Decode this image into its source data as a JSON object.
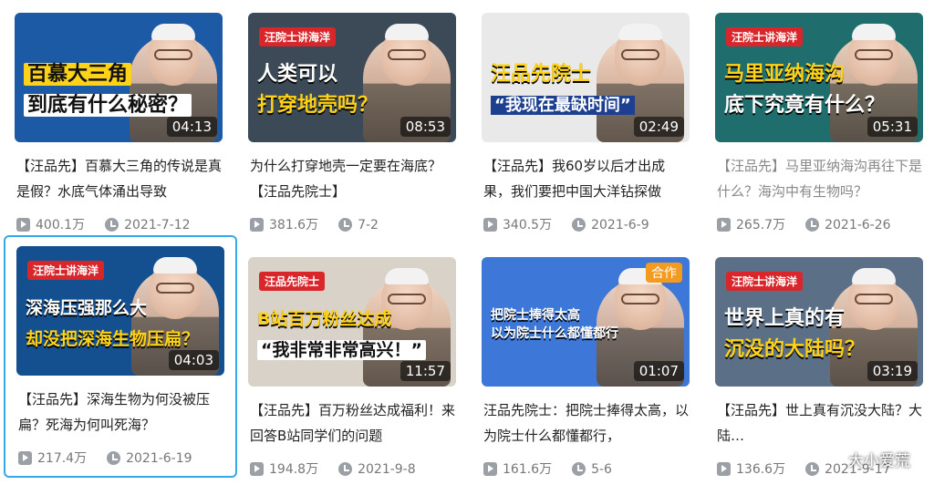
{
  "cards": [
    {
      "tag": "",
      "headline1": "百慕大三角",
      "headline2": "到底有什么秘密？",
      "duration": "04:13",
      "title": "【汪品先】百慕大三角的传说是真是假？水底气体涌出导致",
      "views": "400.1万",
      "date": "2021-7-12",
      "bg": "#1c5aa6"
    },
    {
      "tag": "汪院士讲海洋",
      "headline1": "人类可以",
      "headline2": "打穿地壳吗？",
      "duration": "08:53",
      "title": "为什么打穿地壳一定要在海底？【汪品先院士】",
      "views": "381.6万",
      "date": "7-2",
      "bg": "#3b4a56"
    },
    {
      "tag": "",
      "headline1": "汪品先院士",
      "headline2": "“我现在最缺时间”",
      "duration": "02:49",
      "title": "【汪品先】我60岁以后才出成果，我们要把中国大洋钻探做",
      "views": "340.5万",
      "date": "2021-6-9",
      "bg": "#e9e9e9"
    },
    {
      "tag": "汪院士讲海洋",
      "headline1": "马里亚纳海沟",
      "headline2": "底下究竟有什么？",
      "duration": "05:31",
      "title": "【汪品先】马里亚纳海沟再往下是什么？海沟中有生物吗？",
      "views": "265.7万",
      "date": "2021-6-26",
      "bg": "#1f6d6c"
    },
    {
      "tag": "汪院士讲海洋",
      "headline1": "深海压强那么大",
      "headline2": "却没把深海生物压扁？",
      "duration": "04:03",
      "title": "【汪品先】深海生物为何没被压扁？死海为何叫死海？",
      "views": "217.4万",
      "date": "2021-6-19",
      "bg": "#14508f"
    },
    {
      "tag": "汪品先院士",
      "headline1": "B站百万粉丝达成",
      "headline2": "“我非常非常高兴！”",
      "duration": "11:57",
      "title": "【汪品先】百万粉丝达成福利！来回答B站同学们的问题",
      "views": "194.8万",
      "date": "2021-9-8",
      "bg": "#d9d2c8"
    },
    {
      "tag": "",
      "headline1": "把院士捧得太高",
      "headline2": "以为院士什么都懂都行",
      "duration": "01:07",
      "title": "汪品先院士：把院士捧得太高，以为院士什么都懂都行，",
      "views": "161.6万",
      "date": "5-6",
      "bg": "#3d78d8",
      "badge": "合作"
    },
    {
      "tag": "汪院士讲海洋",
      "headline1": "世界上真的有",
      "headline2": "沉没的大陆吗？",
      "duration": "03:19",
      "title": "【汪品先】世上真有沉没大陆？大陆…",
      "views": "136.6万",
      "date": "2021-9-17",
      "bg": "#5b6f86",
      "watermark": "大小爱荒"
    }
  ]
}
